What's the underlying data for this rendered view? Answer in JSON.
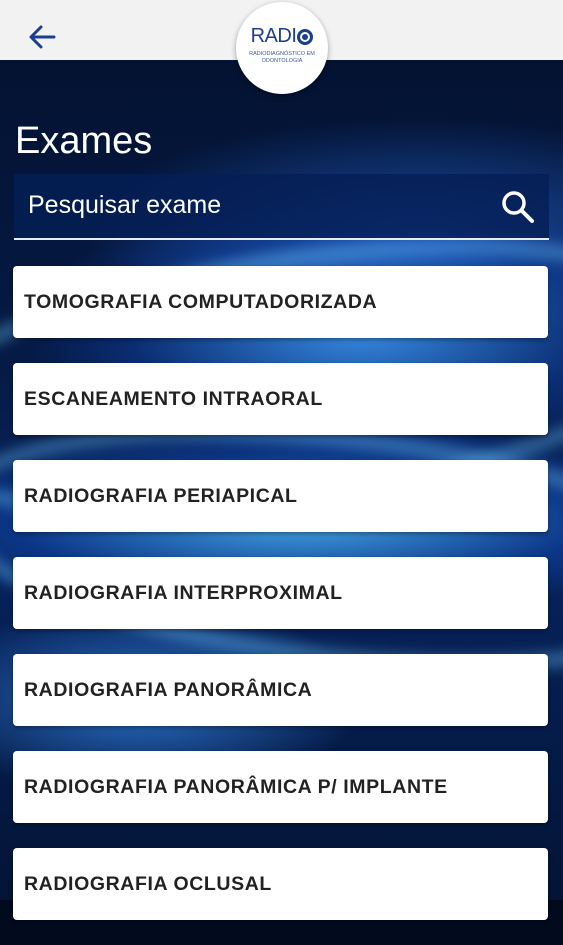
{
  "header": {
    "back_icon": "arrow-left-icon",
    "logo": {
      "word": "RADI",
      "tagline": "RADIODIAGNÓSTICO EM ODONTOLOGIA"
    }
  },
  "page": {
    "title": "Exames"
  },
  "search": {
    "placeholder": "Pesquisar exame",
    "value": "",
    "icon": "search-icon"
  },
  "exams": [
    {
      "label": "TOMOGRAFIA COMPUTADORIZADA"
    },
    {
      "label": "ESCANEAMENTO INTRAORAL"
    },
    {
      "label": "RADIOGRAFIA PERIAPICAL"
    },
    {
      "label": "RADIOGRAFIA INTERPROXIMAL"
    },
    {
      "label": "RADIOGRAFIA PANORÂMICA"
    },
    {
      "label": "RADIOGRAFIA PANORÂMICA P/ IMPLANTE"
    },
    {
      "label": "RADIOGRAFIA OCLUSAL"
    }
  ],
  "colors": {
    "topbar": "#f2f2f2",
    "accent": "#1b3f8f",
    "background": "#051a45"
  }
}
